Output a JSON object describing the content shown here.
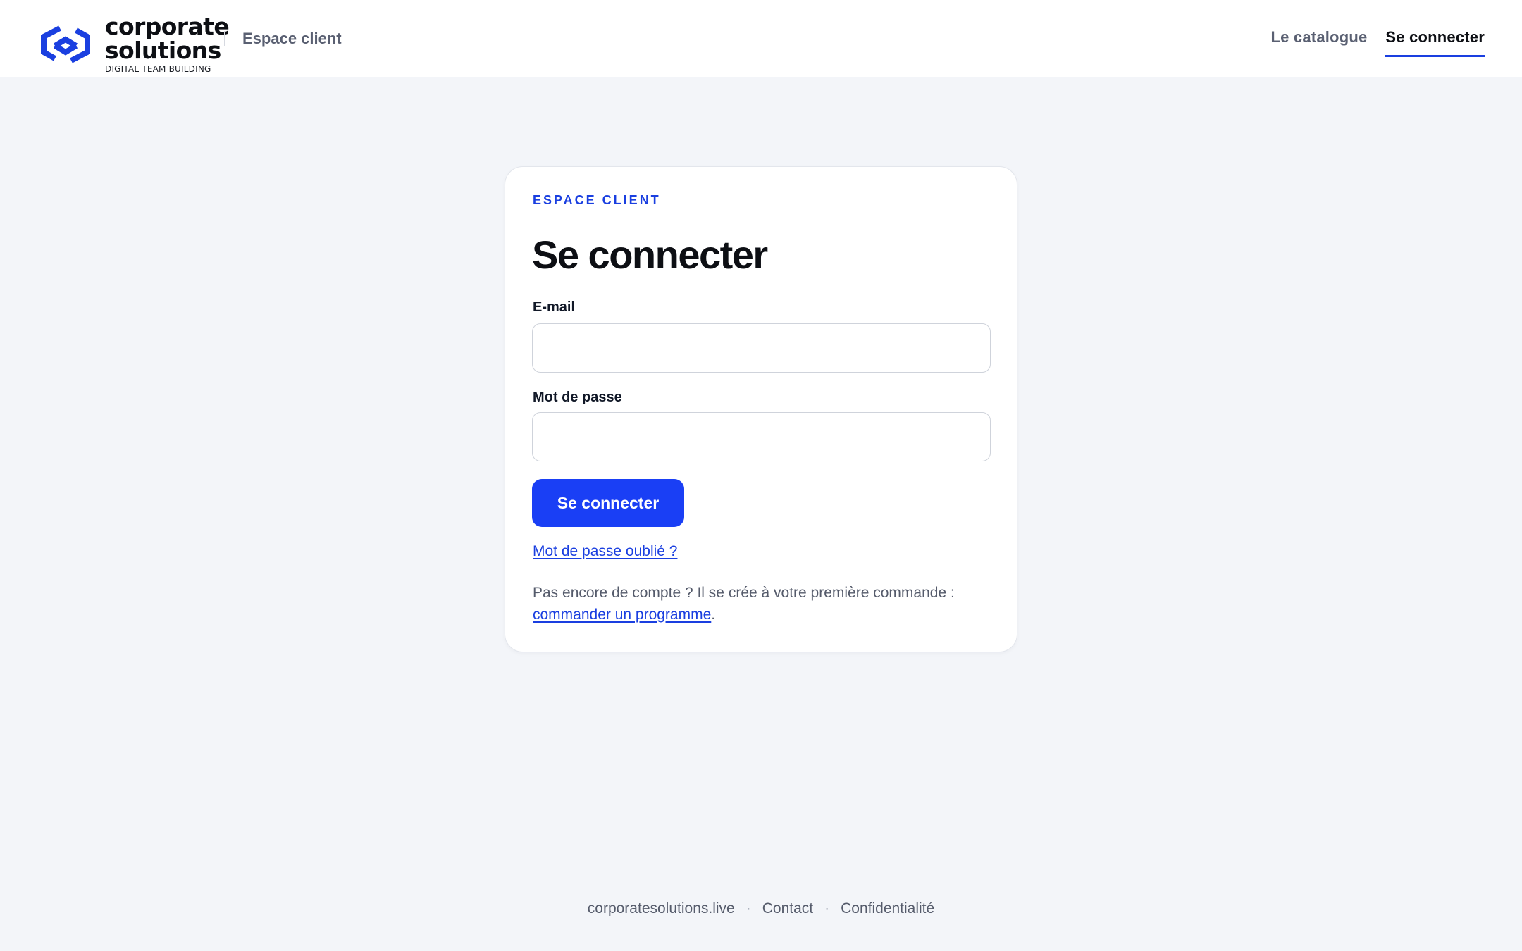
{
  "header": {
    "logo": {
      "word1": "corporate",
      "word2": "solutions",
      "tagline": "DIGITAL TEAM BUILDING",
      "icon": "hexagon-logo-icon",
      "color": "#1a3fe0"
    },
    "section": "Espace client",
    "nav": [
      {
        "label": "Le catalogue",
        "active": false
      },
      {
        "label": "Se connecter",
        "active": true
      }
    ]
  },
  "login": {
    "eyebrow": "ESPACE CLIENT",
    "title": "Se connecter",
    "email_label": "E-mail",
    "email_value": "",
    "password_label": "Mot de passe",
    "password_value": "",
    "submit_label": "Se connecter",
    "forgot_link": "Mot de passe oublié ?",
    "signup_text": "Pas encore de compte ? Il se crée à votre première commande :",
    "signup_link": "commander un programme",
    "signup_suffix": "."
  },
  "footer": {
    "links": [
      "corporatesolutions.live",
      "Contact",
      "Confidentialité"
    ],
    "separator": "·"
  },
  "colors": {
    "accent": "#1a3ff5",
    "link": "#1a3fe0",
    "background": "#f3f5f9"
  }
}
